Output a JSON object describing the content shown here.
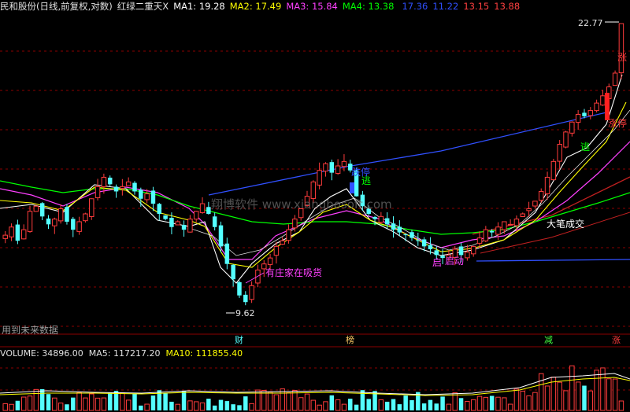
{
  "header": {
    "title": "民和股份(日线,前复权,对数)",
    "indicator": "红绿二重天X",
    "ma1": "MA1: 19.28",
    "ma2": "MA2: 17.49",
    "ma3": "MA3: 15.84",
    "ma4": "MA4: 13.38",
    "v1": "17.36",
    "v2": "11.22",
    "v3": "13.15",
    "v4": "13.88"
  },
  "price_labels": {
    "high": "22.77",
    "low": "9.62"
  },
  "annotations": {
    "accumulating": "有庄家在吸货",
    "launch": "启动",
    "launch_mark": "启",
    "escape_top": "逃",
    "escape_right": "逃",
    "limit_down": "跌停",
    "limit_up": "涨停",
    "big_order": "大笔成交",
    "rise_edge": "涨"
  },
  "watermark": "翔博软件 www.xiangbosoft.com",
  "future_data_note": "用到未来数据",
  "event_tags": {
    "finance": "财",
    "ranking": "榜",
    "reduce": "减",
    "rise": "涨"
  },
  "volume_header": {
    "volume": "VOLUME: 34896.00",
    "ma5": "MA5: 117217.20",
    "ma10": "MA10: 111855.40"
  },
  "colors": {
    "background": "#000000",
    "up": "#ff3c3c",
    "down": "#54ffff",
    "ma1": "#ffffff",
    "ma2": "#ffff00",
    "ma3": "#ff40ff",
    "ma4": "#00ff00",
    "trend_line": "#3050ff",
    "grid": "#8b0000"
  },
  "chart_data": {
    "type": "candlestick",
    "scale": "log",
    "price_range": [
      9.62,
      22.77
    ],
    "candles_close": [
      12.0,
      12.3,
      11.8,
      12.2,
      12.9,
      13.1,
      12.7,
      12.4,
      12.6,
      13.0,
      12.5,
      12.2,
      12.5,
      12.8,
      13.4,
      13.9,
      14.3,
      14.0,
      13.7,
      13.9,
      14.1,
      13.7,
      13.4,
      13.6,
      13.2,
      12.8,
      12.6,
      12.3,
      12.5,
      12.2,
      12.6,
      12.9,
      13.2,
      12.8,
      12.3,
      11.6,
      11.0,
      10.5,
      10.0,
      9.8,
      10.3,
      10.8,
      11.0,
      11.2,
      11.6,
      11.8,
      12.2,
      12.6,
      13.0,
      13.5,
      14.1,
      14.6,
      14.9,
      14.5,
      14.8,
      15.0,
      14.6,
      13.5,
      13.1,
      12.8,
      12.6,
      12.7,
      12.4,
      12.2,
      12.1,
      12.0,
      11.9,
      11.8,
      11.6,
      11.5,
      11.3,
      11.2,
      11.3,
      11.5,
      11.3,
      11.4,
      11.6,
      11.9,
      12.2,
      12.1,
      12.3,
      12.5,
      12.4,
      12.6,
      12.8,
      13.0,
      13.3,
      13.7,
      14.3,
      15.0,
      15.8,
      16.4,
      16.9,
      17.3,
      17.2,
      17.5,
      17.9,
      18.3,
      18.8,
      19.6,
      22.77
    ],
    "volume_ma": {
      "MA5": 117217.2,
      "MA10": 111855.4
    },
    "last_volume": 34896.0,
    "moving_averages": [
      "MA1: 19.28",
      "MA2: 17.49",
      "MA3: 15.84",
      "MA4: 13.38"
    ]
  }
}
